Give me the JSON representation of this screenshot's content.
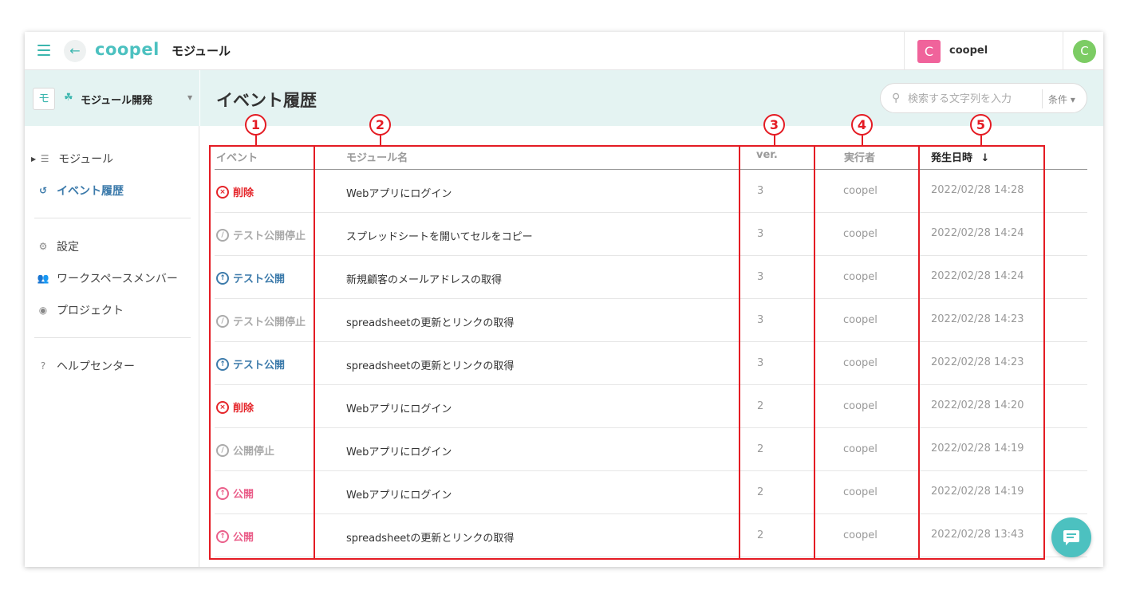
{
  "app": {
    "logo": "coopel",
    "page": "モジュール",
    "back_icon": "←"
  },
  "workspace": {
    "avatar_letter": "C",
    "name": "coopel",
    "avatar_color": "#f0639b"
  },
  "user": {
    "avatar_letter": "C",
    "avatar_color": "#7ccc64"
  },
  "sidebar": {
    "project": {
      "icon_letter": "モ",
      "name": "モジュール開発"
    },
    "items": [
      {
        "label": "モジュール"
      },
      {
        "label": "イベント履歴"
      },
      {
        "label": "設定"
      },
      {
        "label": "ワークスペースメンバー"
      },
      {
        "label": "プロジェクト"
      },
      {
        "label": "ヘルプセンター"
      }
    ]
  },
  "main": {
    "title": "イベント履歴",
    "search": {
      "placeholder": "検索する文字列を入力",
      "condition_label": "条件 ▾"
    }
  },
  "table": {
    "headers": {
      "event": "イベント",
      "module": "モジュール名",
      "ver": "ver.",
      "runner": "実行者",
      "date": "発生日時",
      "sort_arrow": "↓"
    },
    "rows": [
      {
        "event": "削除",
        "type": "delete",
        "module": "Webアプリにログイン",
        "ver": "3",
        "runner": "coopel",
        "date": "2022/02/28 14:28"
      },
      {
        "event": "テスト公開停止",
        "type": "stop",
        "module": "スプレッドシートを開いてセルをコピー",
        "ver": "3",
        "runner": "coopel",
        "date": "2022/02/28 14:24"
      },
      {
        "event": "テスト公開",
        "type": "testpub",
        "module": "新規顧客のメールアドレスの取得",
        "ver": "3",
        "runner": "coopel",
        "date": "2022/02/28 14:24"
      },
      {
        "event": "テスト公開停止",
        "type": "stop",
        "module": "spreadsheetの更新とリンクの取得",
        "ver": "3",
        "runner": "coopel",
        "date": "2022/02/28 14:23"
      },
      {
        "event": "テスト公開",
        "type": "testpub",
        "module": "spreadsheetの更新とリンクの取得",
        "ver": "3",
        "runner": "coopel",
        "date": "2022/02/28 14:23"
      },
      {
        "event": "削除",
        "type": "delete",
        "module": "Webアプリにログイン",
        "ver": "2",
        "runner": "coopel",
        "date": "2022/02/28 14:20"
      },
      {
        "event": "公開停止",
        "type": "stop",
        "module": "Webアプリにログイン",
        "ver": "2",
        "runner": "coopel",
        "date": "2022/02/28 14:19"
      },
      {
        "event": "公開",
        "type": "pub",
        "module": "Webアプリにログイン",
        "ver": "2",
        "runner": "coopel",
        "date": "2022/02/28 14:19"
      },
      {
        "event": "公開",
        "type": "pub",
        "module": "spreadsheetの更新とリンクの取得",
        "ver": "2",
        "runner": "coopel",
        "date": "2022/02/28 13:43"
      }
    ]
  },
  "annotations": [
    "1",
    "2",
    "3",
    "4",
    "5"
  ],
  "colors": {
    "accent": "#4cc1c0",
    "delete": "#e5252a",
    "test_publish": "#3d7bab",
    "publish": "#ea5f8a",
    "annotation": "#e41b23"
  }
}
